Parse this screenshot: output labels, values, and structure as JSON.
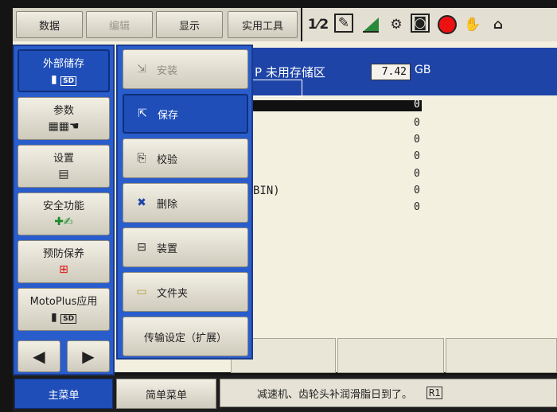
{
  "top_menu": {
    "items": [
      {
        "label": "数据",
        "dim": false
      },
      {
        "label": "编辑",
        "dim": true
      },
      {
        "label": "显示",
        "dim": false
      },
      {
        "label": "实用工具",
        "dim": false
      }
    ]
  },
  "toolbar_icons": [
    "coordinate-icon",
    "edit-icon",
    "signal-icon",
    "tool-icon",
    "camera-icon",
    "record-stop-icon",
    "hand-icon",
    "home-lock-icon"
  ],
  "left_menu": {
    "items": [
      {
        "label": "外部储存",
        "icon": "sd-card-icon",
        "selected": true
      },
      {
        "label": "参数",
        "icon": "parameter-icon",
        "selected": false
      },
      {
        "label": "设置",
        "icon": "settings-panel-icon",
        "selected": false
      },
      {
        "label": "安全功能",
        "icon": "safety-icon",
        "selected": false
      },
      {
        "label": "预防保养",
        "icon": "first-aid-icon",
        "selected": false
      },
      {
        "label": "MotoPlus应用",
        "icon": "sd-card-icon",
        "selected": false
      }
    ]
  },
  "submenu": {
    "items": [
      {
        "label": "安装",
        "icon": "install-icon",
        "state": "dim"
      },
      {
        "label": "保存",
        "icon": "save-sd-icon",
        "state": "selected"
      },
      {
        "label": "校验",
        "icon": "verify-icon",
        "state": "normal"
      },
      {
        "label": "删除",
        "icon": "delete-icon",
        "state": "normal"
      },
      {
        "label": "装置",
        "icon": "device-icon",
        "state": "normal"
      },
      {
        "label": "文件夹",
        "icon": "folder-icon",
        "state": "normal"
      },
      {
        "label": "传输设定（扩展）",
        "icon": "",
        "state": "normal"
      }
    ]
  },
  "content": {
    "title_prefix": "P",
    "title": "未用存储区",
    "free_space": "7.42",
    "unit": "GB",
    "bin_text": "BIN)",
    "zeros": [
      "0",
      "0",
      "0",
      "0",
      "0",
      "0",
      "0"
    ]
  },
  "bottom_bar": {
    "main_menu": "主菜单",
    "simple_menu": "简单菜单",
    "status_message": "减速机、齿轮头补润滑脂日到了。",
    "status_tag": "R1"
  },
  "colors": {
    "accent_blue": "#1f4eb8",
    "panel_blue": "#2a5dcc",
    "background": "#f3f0e0"
  }
}
